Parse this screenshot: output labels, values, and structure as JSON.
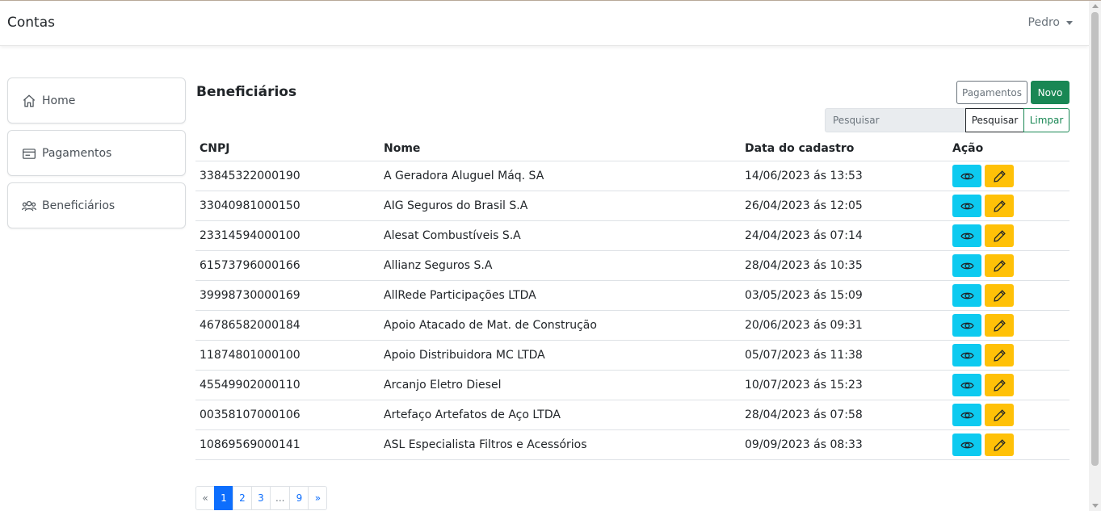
{
  "navbar": {
    "brand": "Contas",
    "user": "Pedro"
  },
  "sidebar": {
    "items": [
      {
        "label": "Home",
        "icon": "home-icon"
      },
      {
        "label": "Pagamentos",
        "icon": "wallet-icon"
      },
      {
        "label": "Beneficiários",
        "icon": "users-icon"
      }
    ]
  },
  "main": {
    "title": "Beneficiários",
    "buttons": {
      "pagamentos": "Pagamentos",
      "novo": "Novo",
      "pesquisar": "Pesquisar",
      "limpar": "Limpar"
    },
    "search_placeholder": "Pesquisar"
  },
  "table": {
    "headers": {
      "cnpj": "CNPJ",
      "nome": "Nome",
      "data": "Data do cadastro",
      "acao": "Ação"
    },
    "rows": [
      {
        "cnpj": "33845322000190",
        "nome": "A Geradora Aluguel Máq. SA",
        "data": "14/06/2023 ás 13:53"
      },
      {
        "cnpj": "33040981000150",
        "nome": "AIG Seguros do Brasil S.A",
        "data": "26/04/2023 ás 12:05"
      },
      {
        "cnpj": "23314594000100",
        "nome": "Alesat Combustíveis S.A",
        "data": "24/04/2023 ás 07:14"
      },
      {
        "cnpj": "61573796000166",
        "nome": "Allianz Seguros S.A",
        "data": "28/04/2023 ás 10:35"
      },
      {
        "cnpj": "39998730000169",
        "nome": "AllRede Participações LTDA",
        "data": "03/05/2023 ás 15:09"
      },
      {
        "cnpj": "46786582000184",
        "nome": "Apoio Atacado de Mat. de Construção",
        "data": "20/06/2023 ás 09:31"
      },
      {
        "cnpj": "11874801000100",
        "nome": "Apoio Distribuidora MC LTDA",
        "data": "05/07/2023 ás 11:38"
      },
      {
        "cnpj": "45549902000110",
        "nome": "Arcanjo Eletro Diesel",
        "data": "10/07/2023 ás 15:23"
      },
      {
        "cnpj": "00358107000106",
        "nome": "Artefaço Artefatos de Aço LTDA",
        "data": "28/04/2023 ás 07:58"
      },
      {
        "cnpj": "10869569000141",
        "nome": "ASL Especialista Filtros e Acessórios",
        "data": "09/09/2023 ás 08:33"
      }
    ]
  },
  "pagination": {
    "prev": "«",
    "pages": [
      "1",
      "2",
      "3",
      "...",
      "9"
    ],
    "next": "»",
    "current": "1"
  },
  "colors": {
    "success": "#198754",
    "info": "#0dcaf0",
    "warning": "#ffc107",
    "primary": "#0d6efd"
  }
}
